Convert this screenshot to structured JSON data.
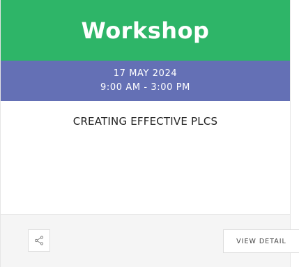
{
  "event": {
    "type_label": "Workshop",
    "date": "17 MAY 2024",
    "time": "9:00 AM - 3:00 PM",
    "title": "CREATING EFFECTIVE PLCS"
  },
  "actions": {
    "share_icon": "share-icon",
    "view_detail_label": "VIEW DETAIL"
  },
  "colors": {
    "header_bg": "#2eb568",
    "datebar_bg": "#6470b5",
    "footer_bg": "#f5f5f5"
  }
}
